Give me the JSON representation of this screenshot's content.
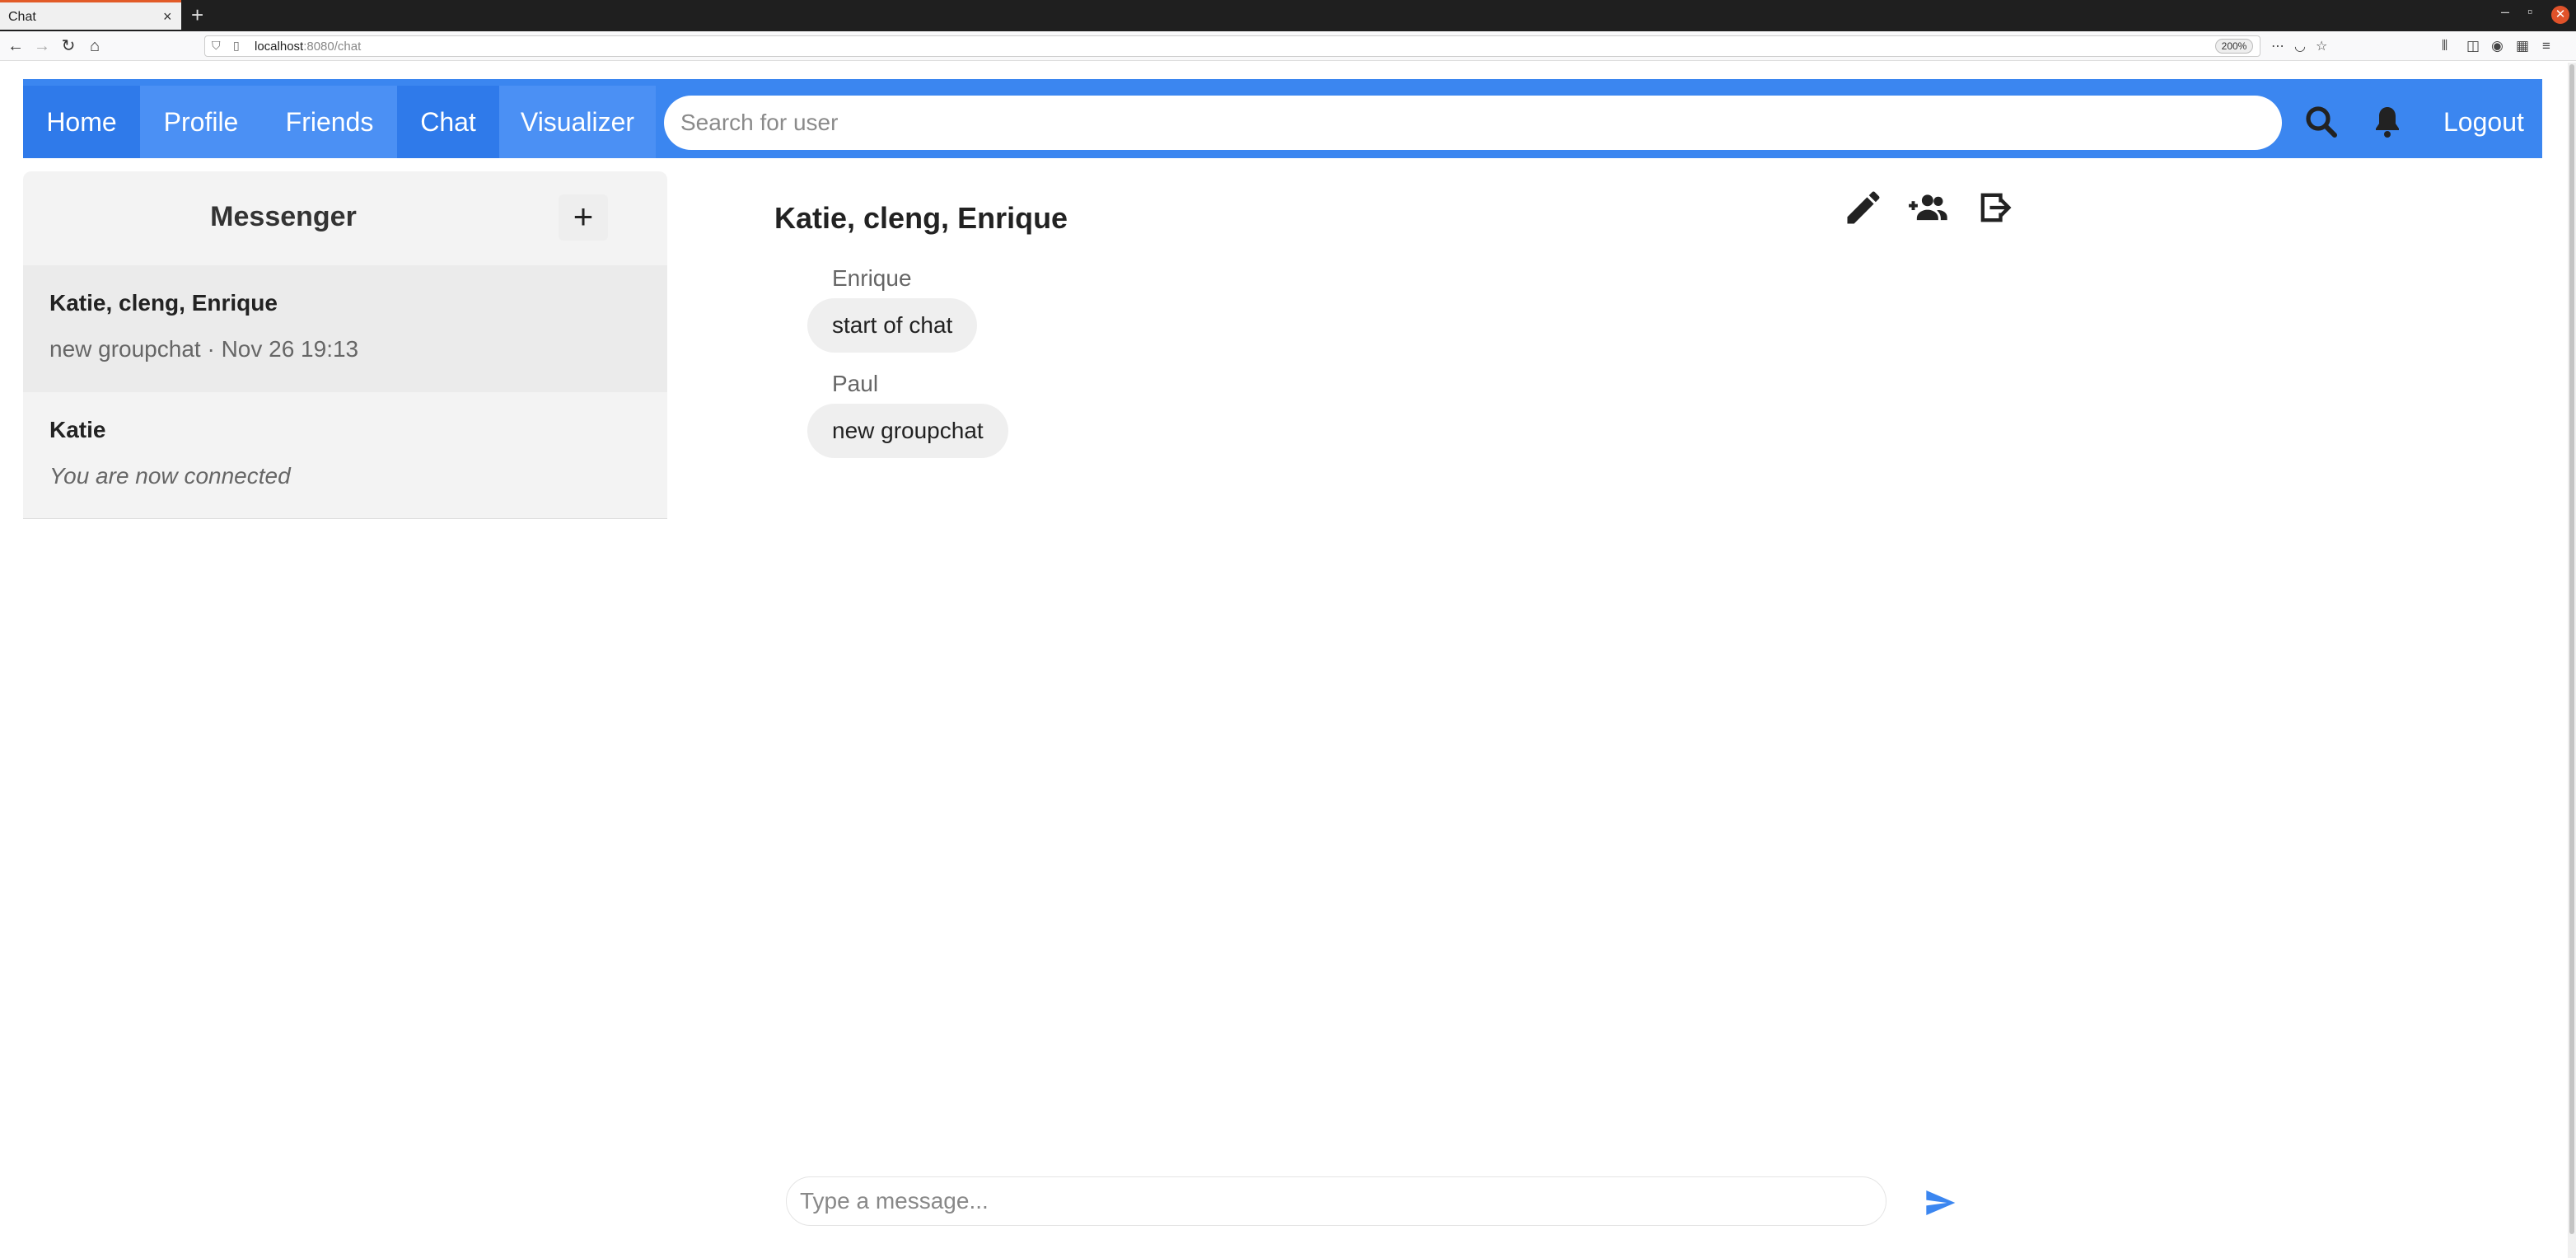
{
  "browser": {
    "tab_title": "Chat",
    "tab_close": "×",
    "new_tab": "+",
    "url_host": "localhost",
    "url_path": ":8080/chat",
    "zoom": "200%"
  },
  "header": {
    "nav": [
      "Home",
      "Profile",
      "Friends",
      "Chat",
      "Visualizer"
    ],
    "active_nav": "Chat",
    "search_placeholder": "Search for user",
    "logout": "Logout",
    "accent_color": "#3b86f0"
  },
  "sidebar": {
    "title": "Messenger",
    "add_label": "+",
    "conversations": [
      {
        "name": "Katie, cleng, Enrique",
        "preview": "new groupchat · Nov 26 19:13",
        "active": true
      },
      {
        "name": "Katie",
        "preview": "You are now connected",
        "active": false
      }
    ]
  },
  "chat": {
    "title": "Katie, cleng, Enrique",
    "messages": [
      {
        "sender": "Enrique",
        "text": "start of chat"
      },
      {
        "sender": "Paul",
        "text": "new groupchat"
      }
    ],
    "input_placeholder": "Type a message..."
  }
}
